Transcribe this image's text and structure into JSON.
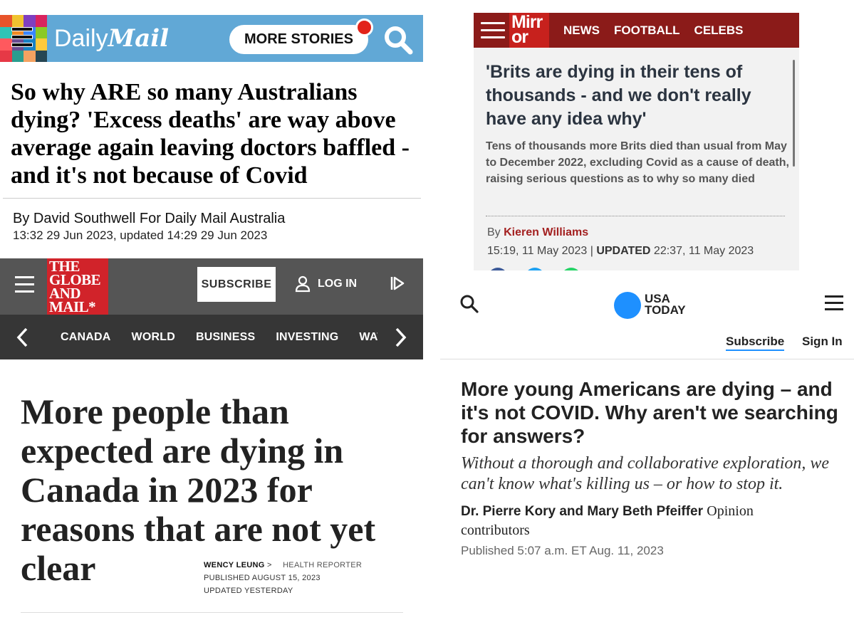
{
  "daily_mail": {
    "brand_prefix": "Daily",
    "brand_name": "Mail",
    "more_stories_label": "MORE STORIES",
    "headline": "So why ARE so many Australians dying? 'Excess deaths' are way above average again leaving doctors baffled - and it's not because of Covid",
    "byline": "By David Southwell For Daily Mail Australia",
    "dateline": "13:32 29 Jun 2023, updated 14:29 29 Jun 2023",
    "colors": {
      "bar": "#61a8d6",
      "notification_dot": "#e2231a"
    }
  },
  "mirror": {
    "logo_line1": "Mirr",
    "logo_line2": "or",
    "nav": [
      "NEWS",
      "FOOTBALL",
      "CELEBS"
    ],
    "headline": "'Brits are dying in their tens of thousands - and we don't really have any idea why'",
    "standfirst": "Tens of thousands more Brits died than usual from May to December 2022, excluding Covid as a cause of death, raising serious questions as to why so many died",
    "by_prefix": "By",
    "author": "Kieren Williams",
    "published": "15:19, 11 May 2023",
    "separator": "|",
    "updated_label": "UPDATED",
    "updated": "22:37, 11 May 2023",
    "colors": {
      "bar": "#8b1b19",
      "logo": "#c7211d",
      "author": "#a32020"
    }
  },
  "globe_and_mail": {
    "logo_lines": [
      "THE",
      "GLOBE",
      "AND",
      "MAIL*"
    ],
    "subscribe_label": "SUBSCRIBE",
    "login_label": "LOG IN",
    "nav": [
      "CANADA",
      "WORLD",
      "BUSINESS",
      "INVESTING",
      "WATCHL"
    ],
    "headline": "More people than expected are dying in Canada in 2023 for reasons that are not yet clear",
    "author": "WENCY LEUNG",
    "author_chevron": ">",
    "role": "HEALTH REPORTER",
    "published": "PUBLISHED AUGUST 15, 2023",
    "updated": "UPDATED YESTERDAY",
    "colors": {
      "bar": "#555555",
      "subnav": "#363636",
      "logo": "#d1232a"
    }
  },
  "usa_today": {
    "logo_line1": "USA",
    "logo_line2": "TODAY",
    "subscribe_label": "Subscribe",
    "signin_label": "Sign In",
    "headline": "More young Americans are dying – and it's not COVID. Why aren't we searching for answers?",
    "dek": "Without a thorough and collaborative exploration, we can't know what's killing us – or how to stop it.",
    "authors": "Dr. Pierre Kory and Mary Beth Pfeiffer",
    "role": "Opinion contributors",
    "published": "Published 5:07 a.m. ET Aug. 11, 2023",
    "colors": {
      "logo": "#1e90ff"
    }
  }
}
